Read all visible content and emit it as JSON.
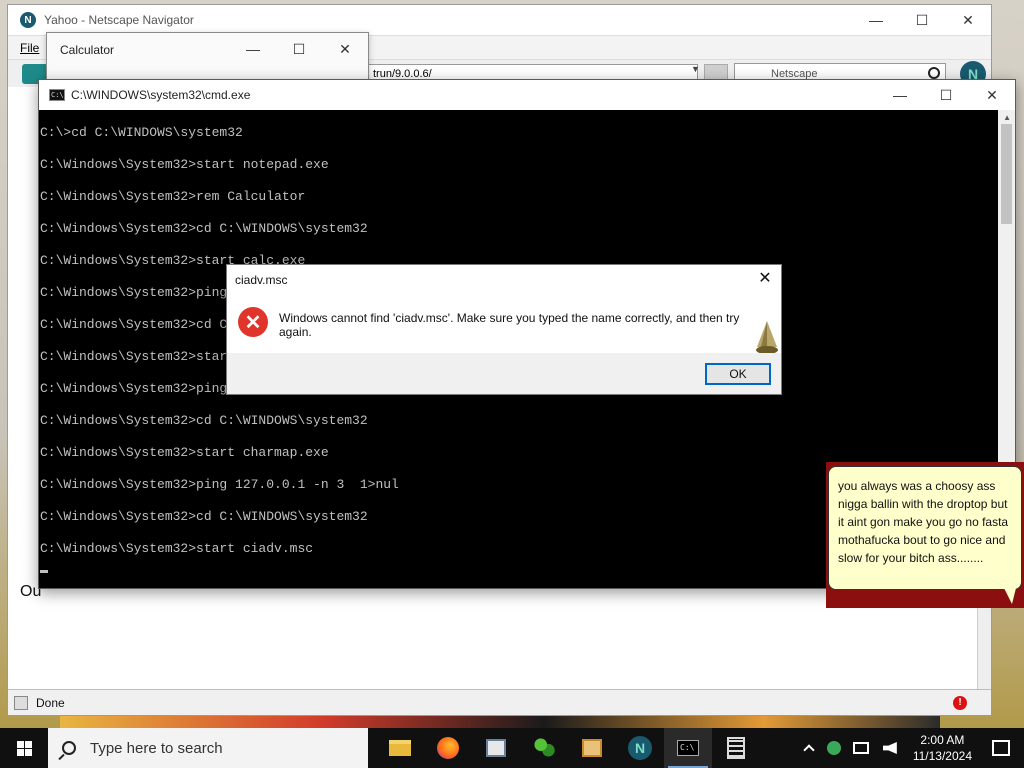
{
  "netscape": {
    "title": "Yahoo - Netscape Navigator",
    "menu_file": "File",
    "url_fragment": "trun/9.0.0.6/",
    "search_provider": "Netscape",
    "page_fragment": "Ou",
    "status_text": "Done",
    "logo_letter": "N"
  },
  "calculator": {
    "title": "Calculator"
  },
  "cmd": {
    "title": "C:\\WINDOWS\\system32\\cmd.exe",
    "lines": [
      "C:\\>cd C:\\WINDOWS\\system32",
      "C:\\Windows\\System32>start notepad.exe",
      "C:\\Windows\\System32>rem Calculator",
      "C:\\Windows\\System32>cd C:\\WINDOWS\\system32",
      "C:\\Windows\\System32>start calc.exe",
      "C:\\Windows\\System32>ping",
      "C:\\Windows\\System32>cd C",
      "C:\\Windows\\System32>star",
      "C:\\Windows\\System32>ping",
      "C:\\Windows\\System32>cd C:\\WINDOWS\\system32",
      "C:\\Windows\\System32>start charmap.exe",
      "C:\\Windows\\System32>ping 127.0.0.1 -n 3  1>nul",
      "C:\\Windows\\System32>cd C:\\WINDOWS\\system32",
      "C:\\Windows\\System32>start ciadv.msc"
    ]
  },
  "dialog": {
    "title": "ciadv.msc",
    "message": "Windows cannot find 'ciadv.msc'. Make sure you typed the name correctly, and then try again.",
    "ok_label": "OK",
    "close_glyph": "✕",
    "error_glyph": "✕"
  },
  "bubble": {
    "text": "you always was a choosy ass nigga ballin with the droptop but it aint gon make you go no fasta mothafucka bout to go nice and slow for your bitch ass........"
  },
  "window_controls": {
    "minimize": "—",
    "maximize": "☐",
    "close": "✕"
  },
  "taskbar": {
    "search_placeholder": "Type here to search",
    "time": "2:00 AM",
    "date": "11/13/2024"
  },
  "colors": {
    "cmd_bg": "#000000",
    "cmd_text": "#c0c0c0",
    "error_red": "#e0352b",
    "ok_focus": "#0066cc",
    "bubble_bg": "#ffffcc",
    "taskbar_bg": "#101010"
  }
}
